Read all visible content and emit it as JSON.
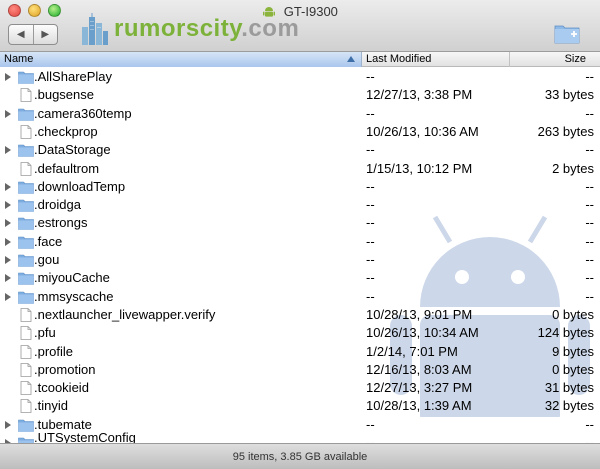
{
  "window": {
    "title": "GT-I9300"
  },
  "brand": {
    "text": "rumorscity",
    "suffix": ".com"
  },
  "colors": {
    "brand_green": "#7db23a",
    "header_selected": "#a9c6ec",
    "android_watermark": "#a4b8d8"
  },
  "columns": {
    "name": "Name",
    "modified": "Last Modified",
    "size": "Size"
  },
  "files": [
    {
      "name": ".AllSharePlay",
      "type": "folder",
      "modified": "--",
      "size": "--"
    },
    {
      "name": ".bugsense",
      "type": "file",
      "modified": "12/27/13, 3:38 PM",
      "size": "33 bytes"
    },
    {
      "name": ".camera360temp",
      "type": "folder",
      "modified": "--",
      "size": "--"
    },
    {
      "name": ".checkprop",
      "type": "file",
      "modified": "10/26/13, 10:36 AM",
      "size": "263 bytes"
    },
    {
      "name": ".DataStorage",
      "type": "folder",
      "modified": "--",
      "size": "--"
    },
    {
      "name": ".defaultrom",
      "type": "file",
      "modified": "1/15/13, 10:12 PM",
      "size": "2 bytes"
    },
    {
      "name": ".downloadTemp",
      "type": "folder",
      "modified": "--",
      "size": "--"
    },
    {
      "name": ".droidga",
      "type": "folder",
      "modified": "--",
      "size": "--"
    },
    {
      "name": ".estrongs",
      "type": "folder",
      "modified": "--",
      "size": "--"
    },
    {
      "name": ".face",
      "type": "folder",
      "modified": "--",
      "size": "--"
    },
    {
      "name": ".gou",
      "type": "folder",
      "modified": "--",
      "size": "--"
    },
    {
      "name": ".miyouCache",
      "type": "folder",
      "modified": "--",
      "size": "--"
    },
    {
      "name": ".mmsyscache",
      "type": "folder",
      "modified": "--",
      "size": "--"
    },
    {
      "name": ".nextlauncher_livewapper.verify",
      "type": "file",
      "modified": "10/28/13, 9:01 PM",
      "size": "0 bytes"
    },
    {
      "name": ".pfu",
      "type": "file",
      "modified": "10/26/13, 10:34 AM",
      "size": "124 bytes"
    },
    {
      "name": ".profile",
      "type": "file",
      "modified": "1/2/14, 7:01 PM",
      "size": "9 bytes"
    },
    {
      "name": ".promotion",
      "type": "file",
      "modified": "12/16/13, 8:03 AM",
      "size": "0 bytes"
    },
    {
      "name": ".tcookieid",
      "type": "file",
      "modified": "12/27/13, 3:27 PM",
      "size": "31 bytes"
    },
    {
      "name": ".tinyid",
      "type": "file",
      "modified": "10/28/13, 1:39 AM",
      "size": "32 bytes"
    },
    {
      "name": ".tubemate",
      "type": "folder",
      "modified": "--",
      "size": "--"
    },
    {
      "name": ".UTSystemConfig",
      "type": "folder",
      "modified": "--",
      "size": "--"
    }
  ],
  "status": {
    "text": "95 items, 3.85 GB available"
  }
}
